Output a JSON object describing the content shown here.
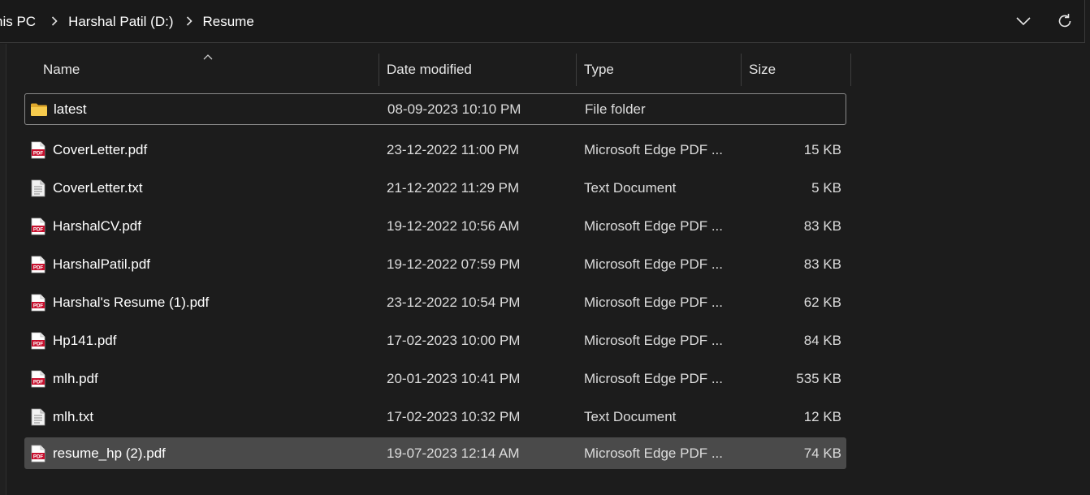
{
  "breadcrumb": [
    "his PC",
    "Harshal Patil (D:)",
    "Resume"
  ],
  "columns": {
    "name": "Name",
    "date": "Date modified",
    "type": "Type",
    "size": "Size"
  },
  "files": [
    {
      "name": "latest",
      "date": "08-09-2023 10:10 PM",
      "type": "File folder",
      "size": "",
      "icon": "folder-icon",
      "state": "focused"
    },
    {
      "name": "CoverLetter.pdf",
      "date": "23-12-2022 11:00 PM",
      "type": "Microsoft Edge PDF ...",
      "size": "15 KB",
      "icon": "pdf-icon",
      "state": ""
    },
    {
      "name": "CoverLetter.txt",
      "date": "21-12-2022 11:29 PM",
      "type": "Text Document",
      "size": "5 KB",
      "icon": "text-file-icon",
      "state": ""
    },
    {
      "name": "HarshalCV.pdf",
      "date": "19-12-2022 10:56 AM",
      "type": "Microsoft Edge PDF ...",
      "size": "83 KB",
      "icon": "pdf-icon",
      "state": ""
    },
    {
      "name": "HarshalPatil.pdf",
      "date": "19-12-2022 07:59 PM",
      "type": "Microsoft Edge PDF ...",
      "size": "83 KB",
      "icon": "pdf-icon",
      "state": ""
    },
    {
      "name": "Harshal's Resume (1).pdf",
      "date": "23-12-2022 10:54 PM",
      "type": "Microsoft Edge PDF ...",
      "size": "62 KB",
      "icon": "pdf-icon",
      "state": ""
    },
    {
      "name": "Hp141.pdf",
      "date": "17-02-2023 10:00 PM",
      "type": "Microsoft Edge PDF ...",
      "size": "84 KB",
      "icon": "pdf-icon",
      "state": ""
    },
    {
      "name": "mlh.pdf",
      "date": "20-01-2023 10:41 PM",
      "type": "Microsoft Edge PDF ...",
      "size": "535 KB",
      "icon": "pdf-icon",
      "state": ""
    },
    {
      "name": "mlh.txt",
      "date": "17-02-2023 10:32 PM",
      "type": "Text Document",
      "size": "12 KB",
      "icon": "text-file-icon",
      "state": ""
    },
    {
      "name": "resume_hp (2).pdf",
      "date": "19-07-2023 12:14 AM",
      "type": "Microsoft Edge PDF ...",
      "size": "74 KB",
      "icon": "pdf-icon",
      "state": "selected"
    }
  ],
  "pdf_icon_label": "PDF",
  "colors": {
    "background": "#1c1c1c",
    "selected_row": "#4a4a4a",
    "folder": "#f4c64a",
    "pdf_red": "#c8102e"
  }
}
